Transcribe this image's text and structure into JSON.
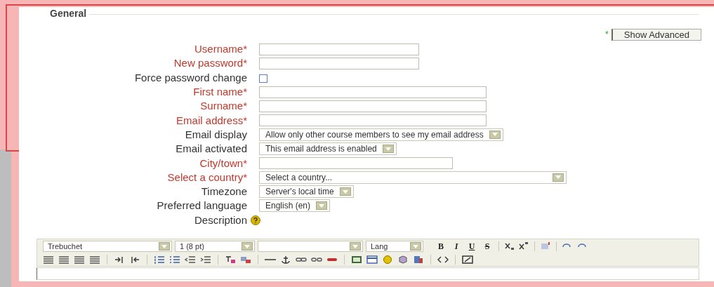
{
  "section": {
    "legend": "General",
    "advanced_button": "Show Advanced",
    "advanced_mark": "*"
  },
  "fields": [
    {
      "label": "Username*",
      "kind": "text",
      "required": true
    },
    {
      "label": "New password*",
      "kind": "text",
      "required": true
    },
    {
      "label": "Force password change",
      "kind": "checkbox",
      "required": false,
      "checked": false
    },
    {
      "label": "First name*",
      "kind": "text",
      "required": true
    },
    {
      "label": "Surname*",
      "kind": "text",
      "required": true
    },
    {
      "label": "Email address*",
      "kind": "text",
      "required": true
    },
    {
      "label": "Email display",
      "kind": "select",
      "required": false,
      "value": "Allow only other course members to see my email address"
    },
    {
      "label": "Email activated",
      "kind": "select",
      "required": false,
      "value": "This email address is enabled"
    },
    {
      "label": "City/town*",
      "kind": "text",
      "required": true
    },
    {
      "label": "Select a country*",
      "kind": "select",
      "required": true,
      "value": "Select a country..."
    },
    {
      "label": "Timezone",
      "kind": "select",
      "required": false,
      "value": "Server's local time"
    },
    {
      "label": "Preferred language",
      "kind": "select",
      "required": false,
      "value": "English (en)"
    },
    {
      "label": "Description",
      "kind": "help",
      "required": false
    }
  ],
  "editor": {
    "font": "Trebuchet",
    "size": "1 (8 pt)",
    "lang": "Lang",
    "format_buttons": [
      "B",
      "I",
      "U",
      "S"
    ]
  }
}
